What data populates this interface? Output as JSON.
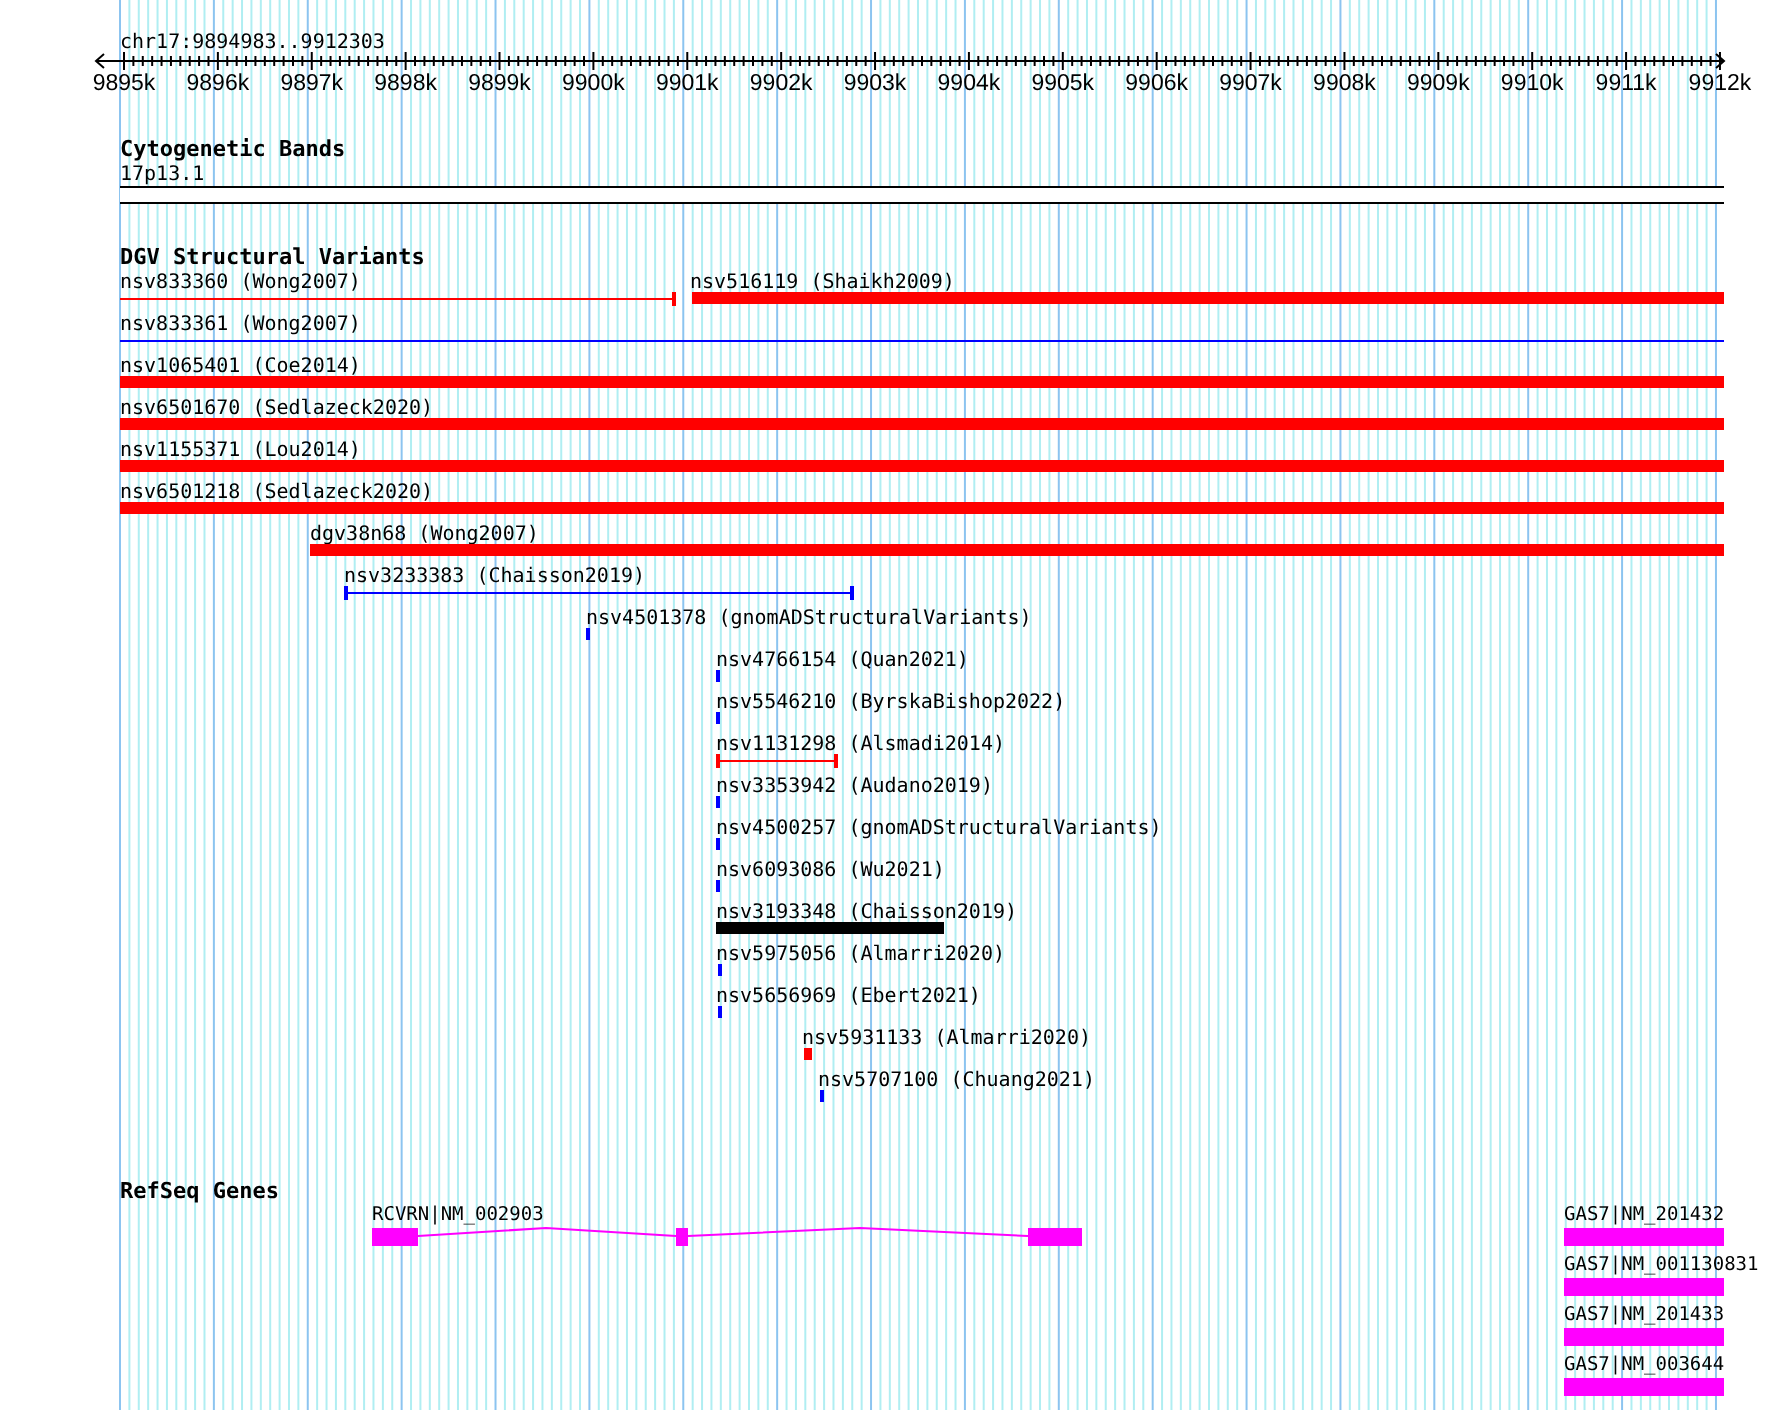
{
  "position": "chr17:9894983..9912303",
  "ruler": {
    "labels": [
      "9895k",
      "9896k",
      "9897k",
      "9898k",
      "9899k",
      "9900k",
      "9901k",
      "9902k",
      "9903k",
      "9904k",
      "9905k",
      "9906k",
      "9907k",
      "9908k",
      "9909k",
      "9910k",
      "9911k",
      "9912k"
    ]
  },
  "cytogenetic_bands": {
    "title": "Cytogenetic Bands",
    "bands": [
      {
        "label": "17p13.1"
      }
    ]
  },
  "dgv_structural_variants": {
    "title": "DGV Structural Variants",
    "rows": [
      {
        "features": [
          {
            "label": "nsv833360 (Wong2007)",
            "color": "#ff0000",
            "kind": "capped-line"
          },
          {
            "label": "nsv516119 (Shaikh2009)",
            "color": "#ff0000",
            "kind": "bar"
          }
        ]
      },
      {
        "features": [
          {
            "label": "nsv833361 (Wong2007)",
            "color": "#0000ff",
            "kind": "line"
          }
        ]
      },
      {
        "features": [
          {
            "label": "nsv1065401 (Coe2014)",
            "color": "#ff0000",
            "kind": "bar"
          }
        ]
      },
      {
        "features": [
          {
            "label": "nsv6501670 (Sedlazeck2020)",
            "color": "#ff0000",
            "kind": "bar"
          }
        ]
      },
      {
        "features": [
          {
            "label": "nsv1155371 (Lou2014)",
            "color": "#ff0000",
            "kind": "bar"
          }
        ]
      },
      {
        "features": [
          {
            "label": "nsv6501218 (Sedlazeck2020)",
            "color": "#ff0000",
            "kind": "bar"
          }
        ]
      },
      {
        "features": [
          {
            "label": "dgv38n68 (Wong2007)",
            "color": "#ff0000",
            "kind": "bar"
          }
        ]
      },
      {
        "features": [
          {
            "label": "nsv3233383 (Chaisson2019)",
            "color": "#0000ff",
            "kind": "capped-line"
          }
        ]
      },
      {
        "features": [
          {
            "label": "nsv4501378 (gnomADStructuralVariants)",
            "color": "#0000ff",
            "kind": "bar"
          }
        ]
      },
      {
        "features": [
          {
            "label": "nsv4766154 (Quan2021)",
            "color": "#0000ff",
            "kind": "bar"
          }
        ]
      },
      {
        "features": [
          {
            "label": "nsv5546210 (ByrskaBishop2022)",
            "color": "#0000ff",
            "kind": "bar"
          }
        ]
      },
      {
        "features": [
          {
            "label": "nsv1131298 (Alsmadi2014)",
            "color": "#ff0000",
            "kind": "capped-line"
          }
        ]
      },
      {
        "features": [
          {
            "label": "nsv3353942 (Audano2019)",
            "color": "#0000ff",
            "kind": "bar"
          }
        ]
      },
      {
        "features": [
          {
            "label": "nsv4500257 (gnomADStructuralVariants)",
            "color": "#0000ff",
            "kind": "bar"
          }
        ]
      },
      {
        "features": [
          {
            "label": "nsv6093086 (Wu2021)",
            "color": "#0000ff",
            "kind": "bar"
          }
        ]
      },
      {
        "features": [
          {
            "label": "nsv3193348 (Chaisson2019)",
            "color": "#000000",
            "kind": "bar"
          }
        ]
      },
      {
        "features": [
          {
            "label": "nsv5975056 (Almarri2020)",
            "color": "#0000ff",
            "kind": "bar"
          }
        ]
      },
      {
        "features": [
          {
            "label": "nsv5656969 (Ebert2021)",
            "color": "#0000ff",
            "kind": "bar"
          }
        ]
      },
      {
        "features": [
          {
            "label": "nsv5931133 (Almarri2020)",
            "color": "#ff0000",
            "kind": "bar"
          }
        ]
      },
      {
        "features": [
          {
            "label": "nsv5707100 (Chuang2021)",
            "color": "#0000ff",
            "kind": "bar"
          }
        ]
      }
    ]
  },
  "refseq_genes": {
    "title": "RefSeq Genes",
    "genes": [
      {
        "label": "RCVRN|NM_002903",
        "kind": "multi-exon"
      },
      {
        "label": "GAS7|NM_201432",
        "kind": "block"
      },
      {
        "label": "GAS7|NM_001130831",
        "kind": "block"
      },
      {
        "label": "GAS7|NM_201433",
        "kind": "block"
      },
      {
        "label": "GAS7|NM_003644",
        "kind": "block"
      }
    ]
  }
}
